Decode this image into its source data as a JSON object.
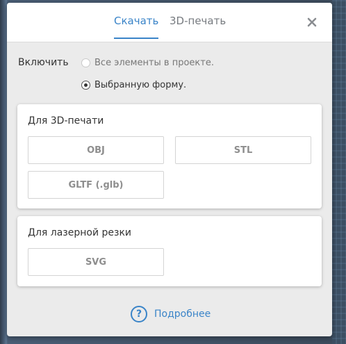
{
  "tabs": [
    {
      "label": "Скачать",
      "active": true
    },
    {
      "label": "3D-печать",
      "active": false
    }
  ],
  "close_icon": "close-icon",
  "include": {
    "label": "Включить",
    "options": [
      {
        "label": "Все элементы в проекте.",
        "checked": false
      },
      {
        "label": "Выбранную форму.",
        "checked": true
      }
    ]
  },
  "print_section": {
    "title": "Для 3D-печати",
    "buttons": [
      "OBJ",
      "STL",
      "GLTF (.glb)"
    ]
  },
  "laser_section": {
    "title": "Для лазерной резки",
    "buttons": [
      "SVG"
    ]
  },
  "help": {
    "icon": "question-circle-icon",
    "label": "Подробнее"
  },
  "colors": {
    "accent": "#3a84c8",
    "dialog_bg": "#ebebeb",
    "card_bg": "#ffffff"
  }
}
